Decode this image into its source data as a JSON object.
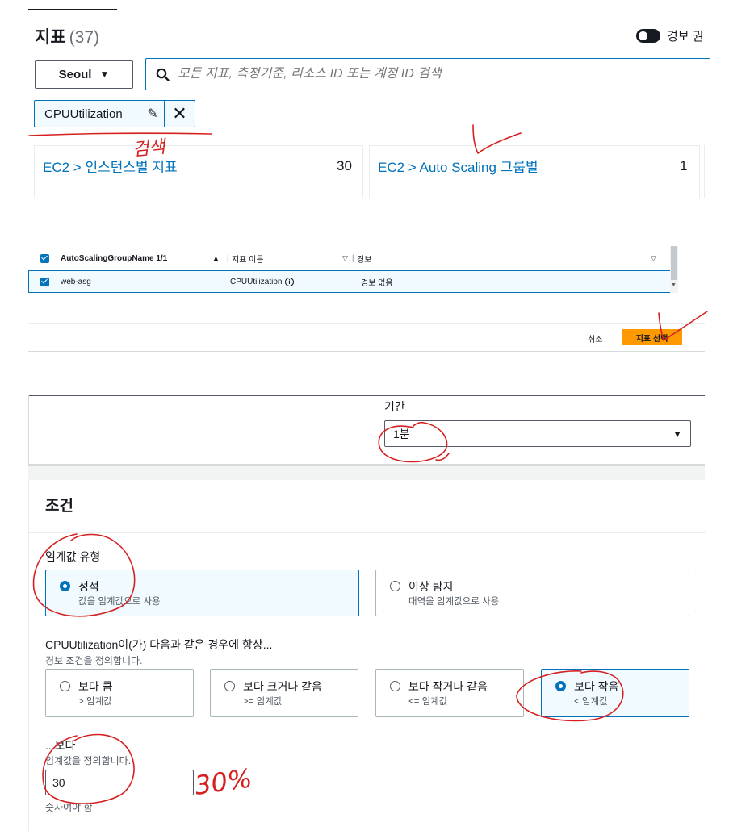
{
  "metrics": {
    "title": "지표",
    "count": "(37)",
    "alarm_toggle_label": "경보 권",
    "region": "Seoul",
    "search_placeholder": "모든 지표, 측정기준, 리소스 ID 또는 계정 ID 검색",
    "token": "CPUUtilization",
    "cards": [
      {
        "label": "EC2 > 인스턴스별 지표",
        "count": "30"
      },
      {
        "label": "EC2 > Auto Scaling 그룹별",
        "count": "1"
      }
    ]
  },
  "table": {
    "headers": [
      "AutoScalingGroupName 1/1",
      "지표 이름",
      "경보"
    ],
    "row": {
      "asg": "web-asg",
      "metric": "CPUUtilization",
      "alarm": "경보 없음"
    },
    "cancel_label": "취소",
    "select_label": "지표 선택"
  },
  "period": {
    "label": "기간",
    "value": "1분"
  },
  "conditions": {
    "title": "조건",
    "threshold_type_label": "임계값 유형",
    "threshold_types": [
      {
        "label": "정적",
        "desc": "값을 임계값으로 사용",
        "selected": true
      },
      {
        "label": "이상 탐지",
        "desc": "대역을 임계값으로 사용",
        "selected": false
      }
    ],
    "when_label": "CPUUtilization이(가) 다음과 같은 경우에 항상...",
    "when_desc": "경보 조건을 정의합니다.",
    "operators": [
      {
        "label": "보다 큼",
        "desc": "> 임계값",
        "selected": false
      },
      {
        "label": "보다 크거나 같음",
        "desc": ">= 임계값",
        "selected": false
      },
      {
        "label": "보다 작거나 같음",
        "desc": "<= 임계값",
        "selected": false
      },
      {
        "label": "보다 작음",
        "desc": "< 임계값",
        "selected": true
      }
    ],
    "than_label": "...보다",
    "than_desc": "임계값을 정의합니다.",
    "threshold_value": "30",
    "threshold_hint": "숫자여야 함"
  },
  "annotations": {
    "search_note": "검색",
    "percent_note": "30%",
    "ink_color": "#d62020"
  }
}
